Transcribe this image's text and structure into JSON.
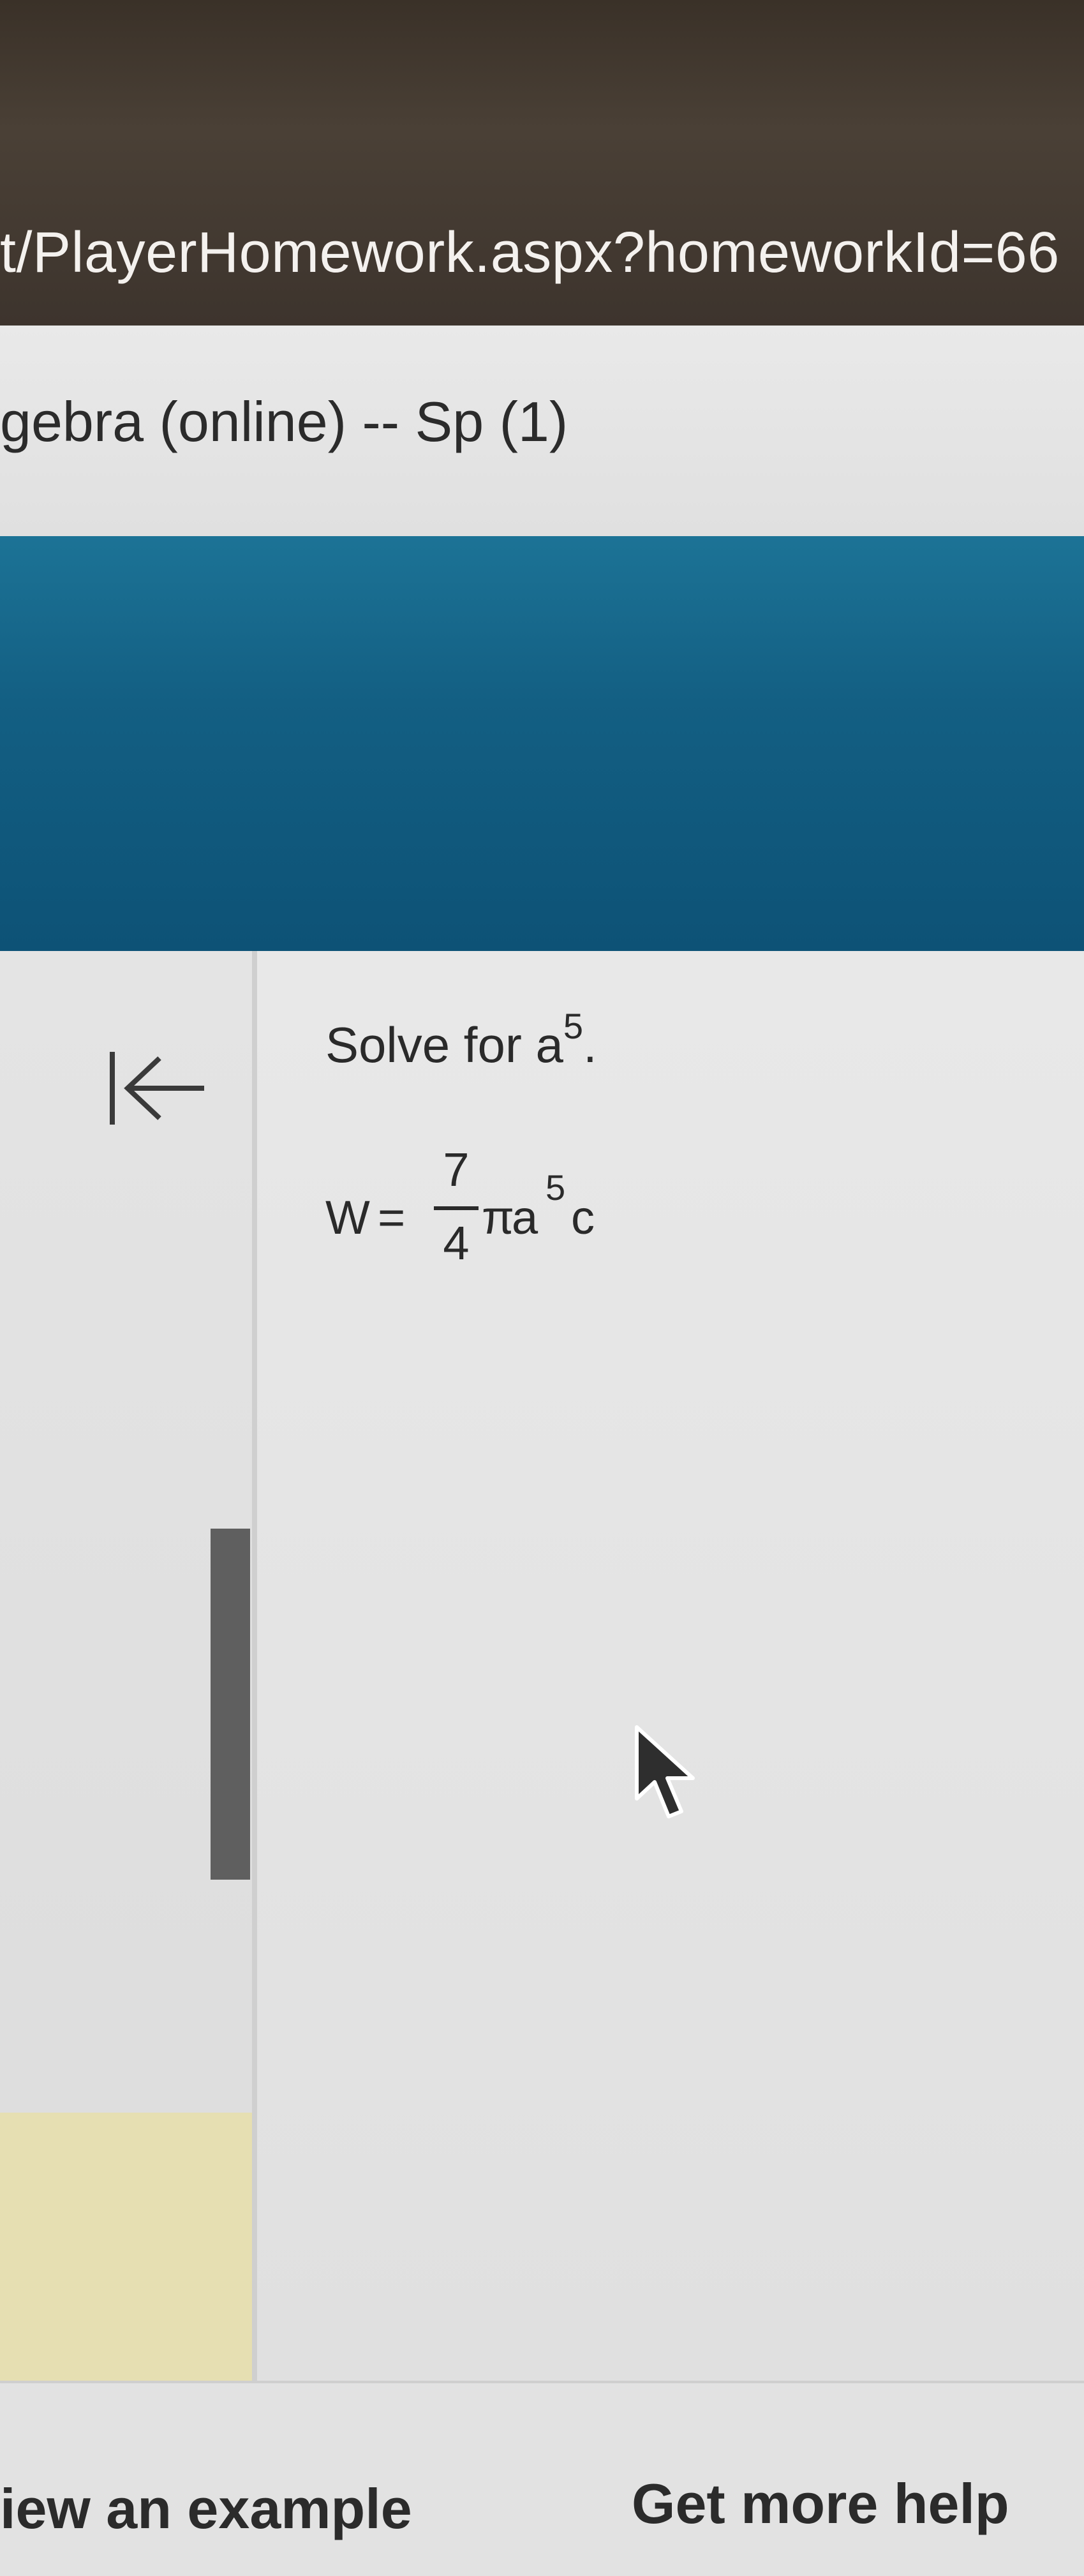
{
  "browser": {
    "url": "t/PlayerHomework.aspx?homeworkId=66"
  },
  "course": {
    "title": "gebra (online) -- Sp (1)"
  },
  "question": {
    "prompt_text": "Solve for a",
    "prompt_exponent": "5",
    "prompt_period": ".",
    "equation": {
      "lhs": "W",
      "equals": "=",
      "fraction_numerator": "7",
      "fraction_denominator": "4",
      "pi": "π",
      "variable": "a",
      "exponent": "5",
      "trailing": "c"
    }
  },
  "footer": {
    "view_example_label": "iew an example",
    "get_more_help_label": "Get more help"
  },
  "icons": {
    "back": "back-to-start-icon",
    "cursor": "mouse-pointer-icon"
  }
}
